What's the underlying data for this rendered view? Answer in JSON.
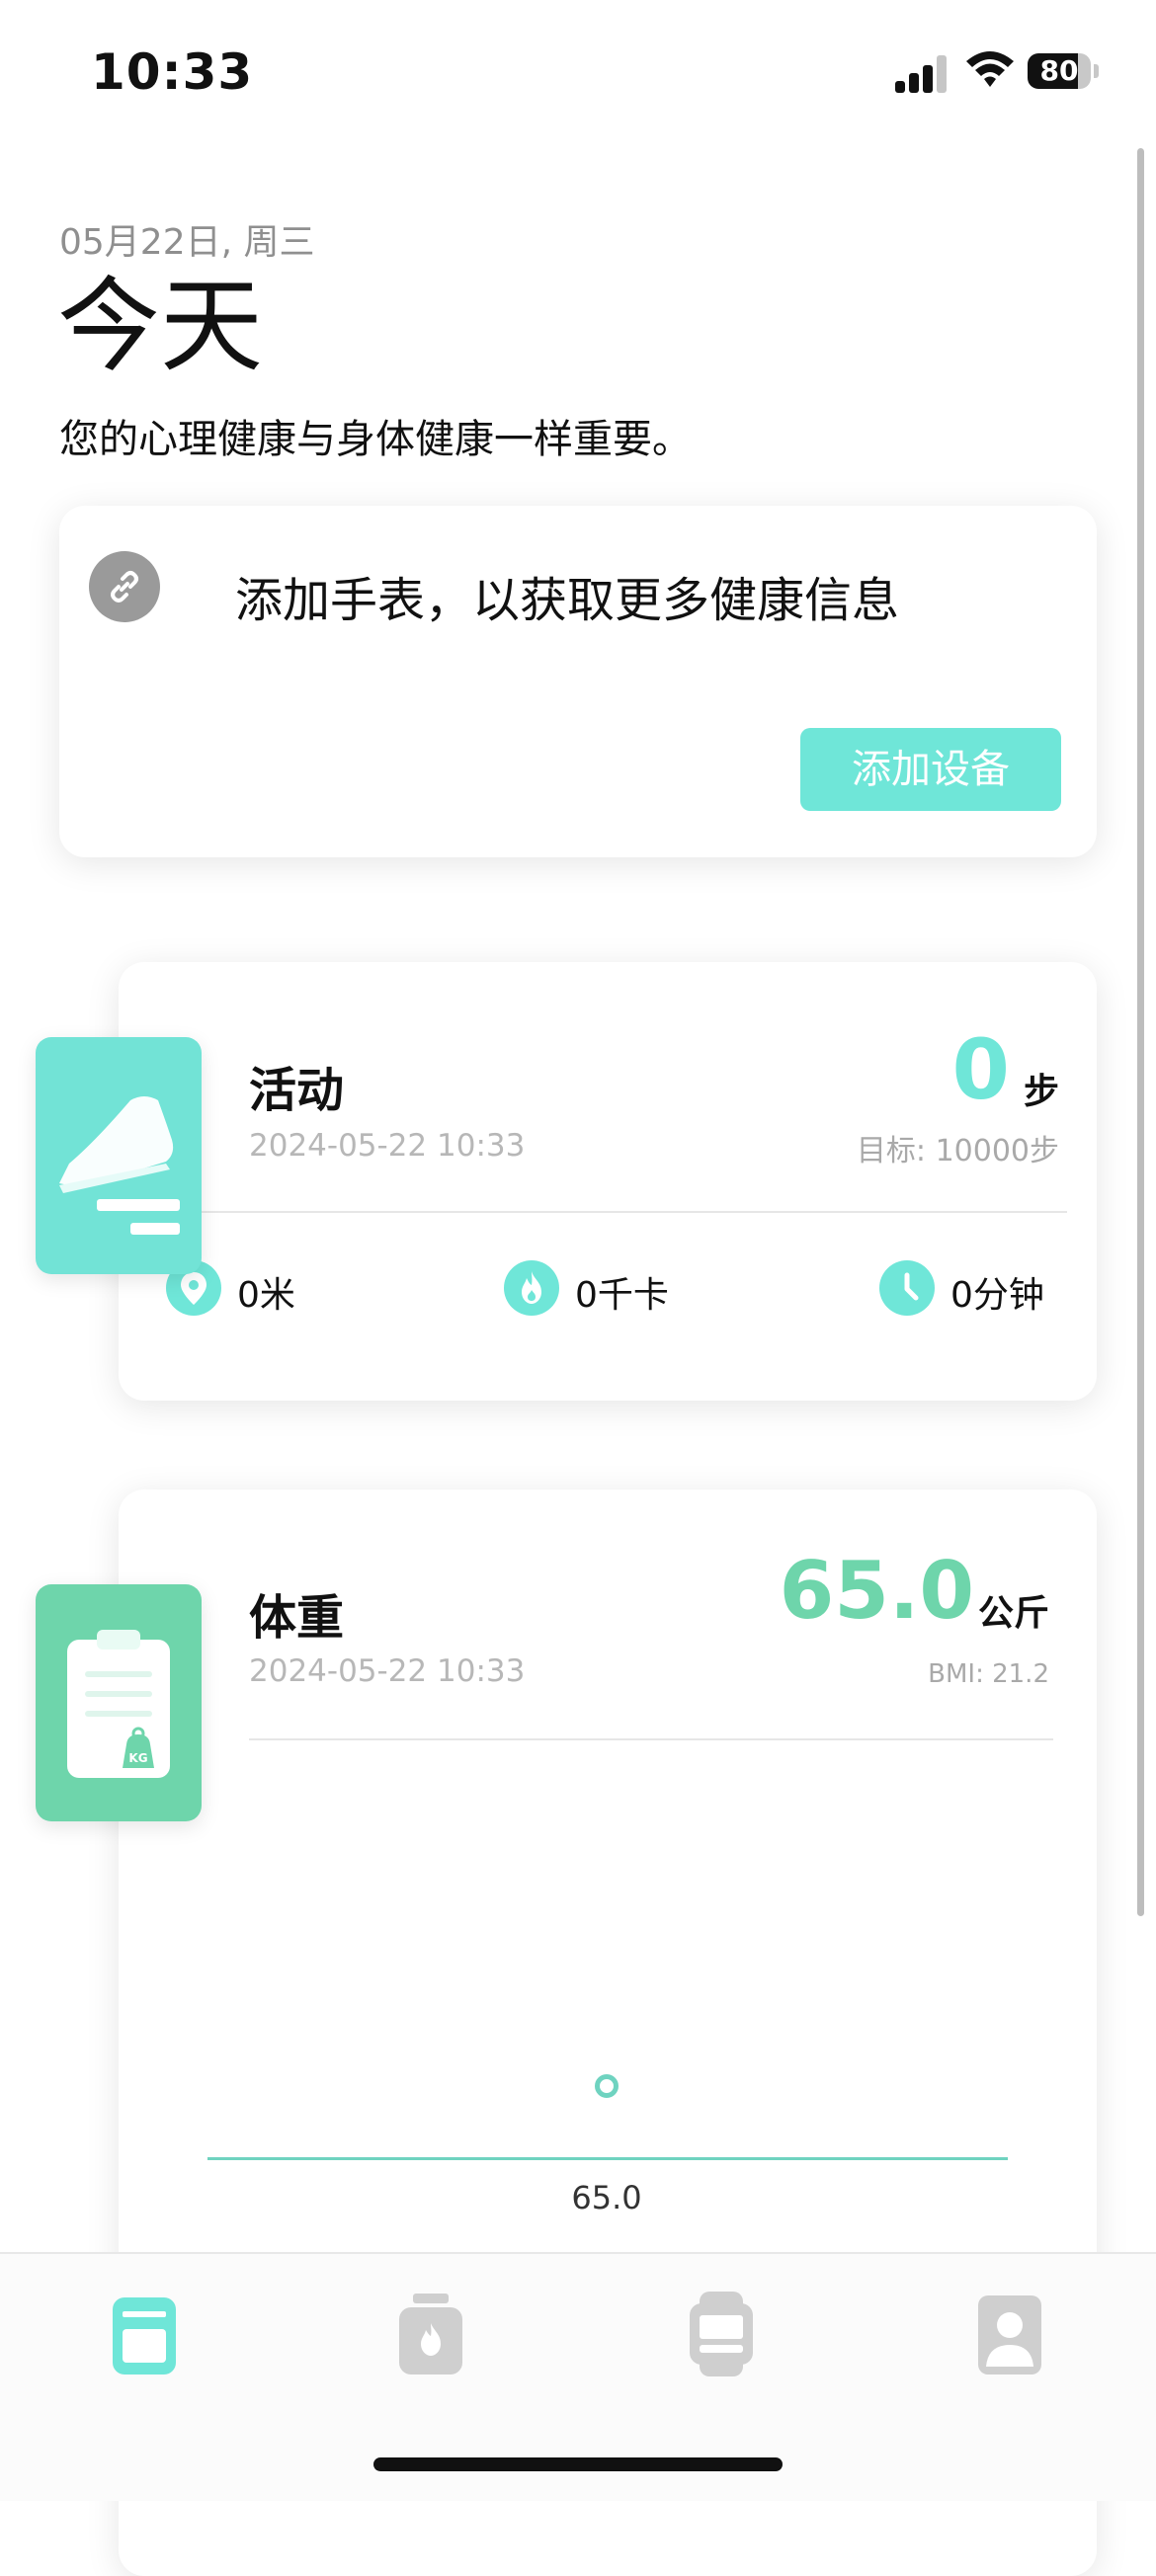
{
  "status_bar": {
    "time": "10:33",
    "battery": "80"
  },
  "header": {
    "date": "05月22日, 周三",
    "title": "今天",
    "subtitle": "您的心理健康与身体健康一样重要。"
  },
  "device_card": {
    "icon": "link-icon",
    "message": "添加手表，以获取更多健康信息",
    "button_label": "添加设备"
  },
  "activity_card": {
    "icon": "sneaker-icon",
    "title": "活动",
    "timestamp": "2024-05-22 10:33",
    "value": "0",
    "unit": "步",
    "goal": "目标: 10000步",
    "stats": [
      {
        "icon": "location-pin-icon",
        "label": "0米"
      },
      {
        "icon": "flame-icon",
        "label": "0千卡"
      },
      {
        "icon": "clock-icon",
        "label": "0分钟"
      }
    ]
  },
  "weight_card": {
    "icon": "clipboard-scale-icon",
    "title": "体重",
    "timestamp": "2024-05-22 10:33",
    "value": "65.0",
    "unit": "公斤",
    "bmi": "BMI: 21.2",
    "chart_point_label": "65.0"
  },
  "tab_bar": {
    "tabs": [
      {
        "icon": "dashboard-icon",
        "active": true
      },
      {
        "icon": "calorie-jar-icon",
        "active": false
      },
      {
        "icon": "watch-icon",
        "active": false
      },
      {
        "icon": "profile-icon",
        "active": false
      }
    ]
  },
  "colors": {
    "accent": "#6FE6D8",
    "weight_green": "#6ED5AB",
    "inactive_gray": "#CFCFCF"
  }
}
